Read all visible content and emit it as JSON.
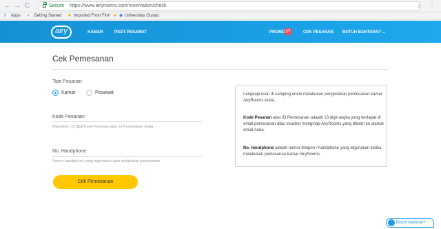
{
  "browser": {
    "nav_back": "←",
    "nav_forward": "→",
    "reload": "C",
    "secure_label": "Secure",
    "url": "https://www.airyrooms.com/reservation/check",
    "star_icon": "star-icon",
    "menu_icon": "⋮"
  },
  "bookmarks": {
    "apps_label": "Apps",
    "items": [
      "Getting Started",
      "Imported From Fire!",
      "Universitas Gunad"
    ]
  },
  "site_nav": {
    "logo_text": "airy",
    "links": [
      "KAMAR",
      "TIKET PESAWAT"
    ],
    "promo_label": "PROMO",
    "promo_count": "17",
    "check_label": "CEK PESANAN",
    "help_label": "BUTUH BANTUAN? ⌄",
    "gradient": [
      "#1491d6",
      "#1ea8ee"
    ]
  },
  "main": {
    "title": "Cek Pemesanan",
    "order_type_label": "Tipe Pesanan",
    "options": [
      "Kamar",
      "Pesawat"
    ],
    "selected_option": "Kamar",
    "order_code_label": "Kode Pesanan:",
    "order_code_placeholder": "Masukkan 13 digit Kode Pesanan atau ID Pemesanan Anda",
    "phone_label": "No. Handphone",
    "phone_placeholder": "Nomor handphone yang digunakan saat melakukan pemesanan",
    "submit_label": "Cek Pemesanan",
    "accent": "#ffc800"
  },
  "info": {
    "intro": "Lengkapi isian di samping untuk melakukan pengecekan pemesanan kamar AiryRooms Anda.",
    "code_term": "Kode Pesanan",
    "code_text": " atau ID Pemesanan adalah 13 digit angka yang terdapat di email pemesanan atau voucher menginap AiryRooms yang dikirim ke alamat email Anda.",
    "phone_term": "No. Handphone",
    "phone_text": " adalah nomor telepon / handphone yang digunakan ketika melakukan pemesanan kamar AiryRooms."
  },
  "help_widget": {
    "label": "Butuh bantuan?",
    "color": "#1e9be8"
  }
}
